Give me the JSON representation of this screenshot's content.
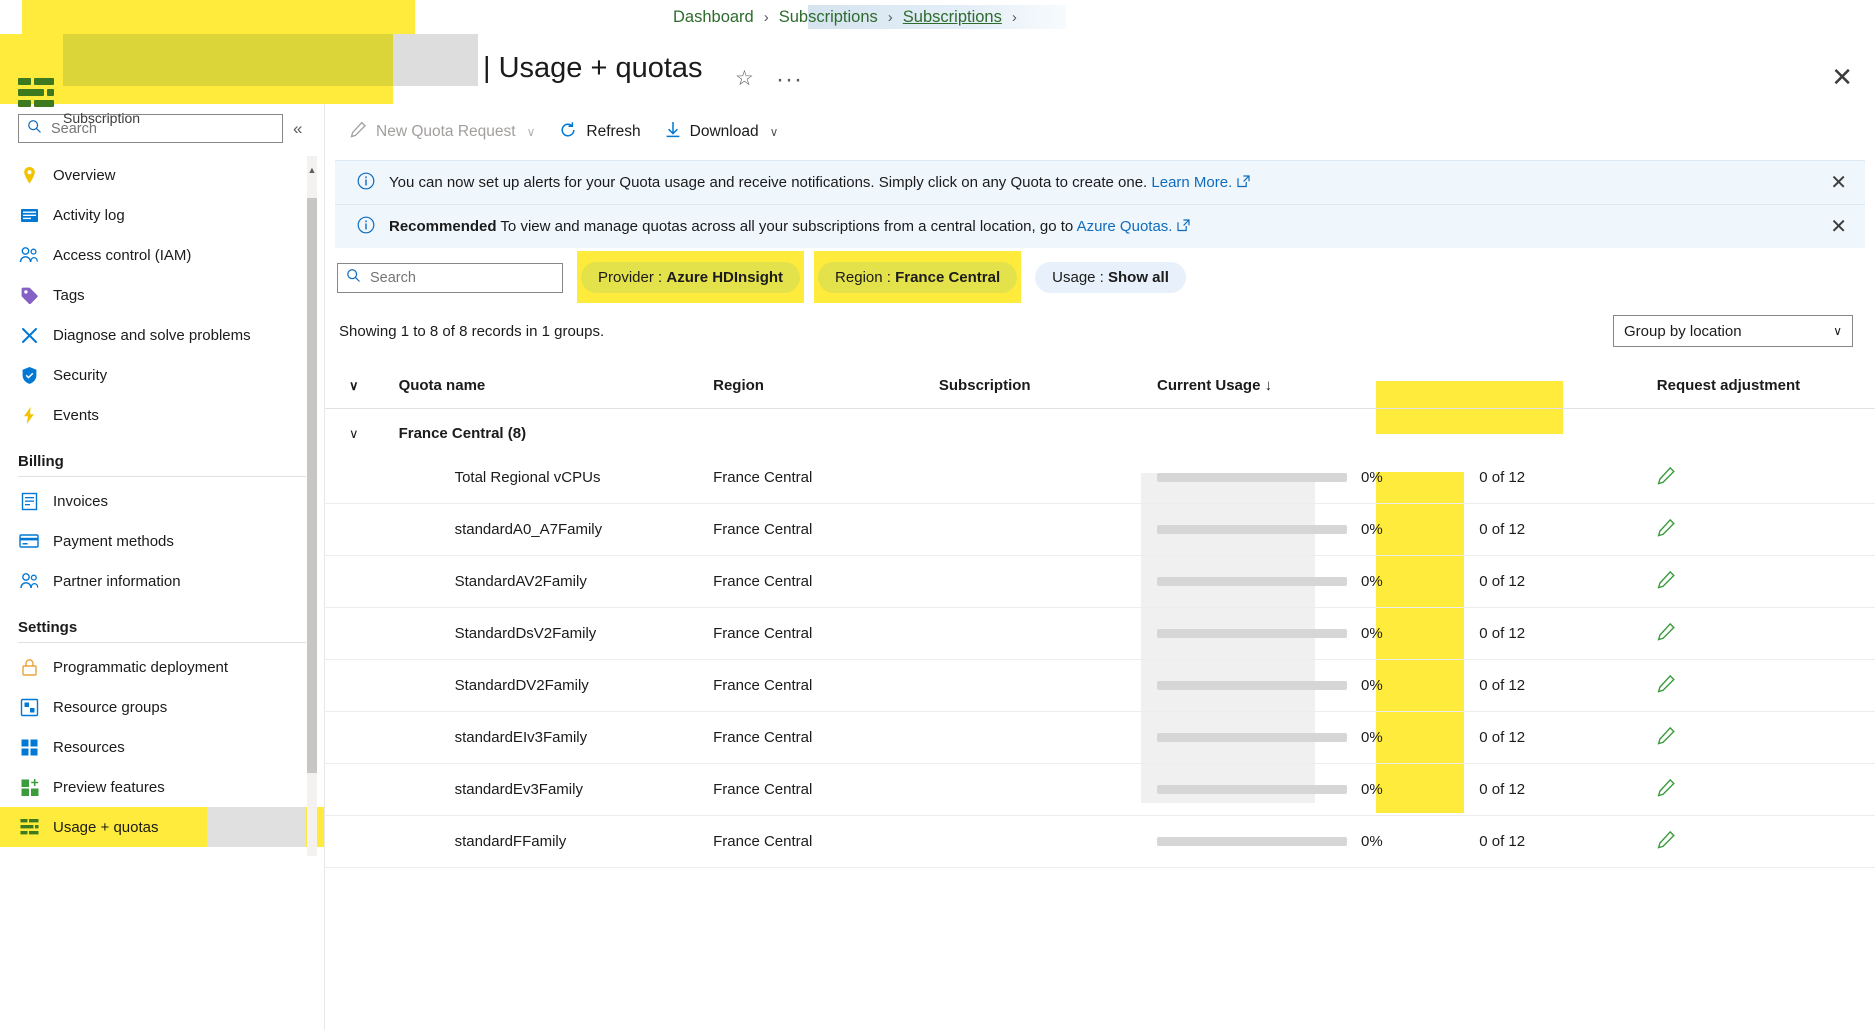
{
  "breadcrumb": {
    "items": [
      {
        "label": "Dashboard",
        "current": false
      },
      {
        "label": "Subscriptions",
        "current": false
      },
      {
        "label": "Subscriptions",
        "current": true
      }
    ],
    "separator": "›"
  },
  "header": {
    "title": "| Usage + quotas",
    "subtitle": "Subscription",
    "favorite_icon": "star-icon",
    "more_icon": "ellipsis-icon",
    "close_icon": "close-icon"
  },
  "sidebar": {
    "search_placeholder": "Search",
    "search_value": "",
    "collapse_label": "«",
    "items": [
      {
        "label": "Overview",
        "icon": "overview-icon",
        "color": "#f2c300",
        "selected": false
      },
      {
        "label": "Activity log",
        "icon": "activity-log-icon",
        "color": "#0078d4",
        "selected": false
      },
      {
        "label": "Access control (IAM)",
        "icon": "access-control-icon",
        "color": "#0078d4",
        "selected": false
      },
      {
        "label": "Tags",
        "icon": "tags-icon",
        "color": "#8661c5",
        "selected": false
      },
      {
        "label": "Diagnose and solve problems",
        "icon": "diagnose-icon",
        "color": "#0078d4",
        "selected": false
      },
      {
        "label": "Security",
        "icon": "security-shield-icon",
        "color": "#0078d4",
        "selected": false
      },
      {
        "label": "Events",
        "icon": "events-bolt-icon",
        "color": "#f2c300",
        "selected": false
      }
    ],
    "sections": [
      {
        "title": "Billing",
        "items": [
          {
            "label": "Invoices",
            "icon": "invoices-icon",
            "color": "#0078d4",
            "selected": false
          },
          {
            "label": "Payment methods",
            "icon": "payment-methods-icon",
            "color": "#0078d4",
            "selected": false
          },
          {
            "label": "Partner information",
            "icon": "partner-information-icon",
            "color": "#0078d4",
            "selected": false
          }
        ]
      },
      {
        "title": "Settings",
        "items": [
          {
            "label": "Programmatic deployment",
            "icon": "programmatic-deployment-icon",
            "color": "#e8a33d",
            "selected": false
          },
          {
            "label": "Resource groups",
            "icon": "resource-groups-icon",
            "color": "#0078d4",
            "selected": false
          },
          {
            "label": "Resources",
            "icon": "resources-icon",
            "color": "#0078d4",
            "selected": false
          },
          {
            "label": "Preview features",
            "icon": "preview-features-icon",
            "color": "#3b9c3b",
            "selected": false
          },
          {
            "label": "Usage + quotas",
            "icon": "usage-quotas-icon",
            "color": "#3d7a1f",
            "selected": true
          }
        ]
      }
    ]
  },
  "toolbar": {
    "new_quota_request": "New Quota Request",
    "new_quota_request_disabled": true,
    "refresh": "Refresh",
    "download": "Download",
    "chevron": "∨"
  },
  "banners": [
    {
      "icon": "info-icon",
      "bold": "",
      "text": "You can now set up alerts for your Quota usage and receive notifications. Simply click on any Quota to create one. ",
      "link": "Learn More.",
      "external_icon": "external-link-icon",
      "close_icon": "close-icon"
    },
    {
      "icon": "info-icon",
      "bold": "Recommended",
      "text": " To view and manage quotas across all your subscriptions from a central location, go to ",
      "link": "Azure Quotas.",
      "external_icon": "external-link-icon",
      "close_icon": "close-icon"
    }
  ],
  "filters": {
    "search_placeholder": "Search",
    "search_value": "",
    "pills": [
      {
        "label": "Provider :",
        "value": "Azure HDInsight",
        "highlighted": true
      },
      {
        "label": "Region :",
        "value": "France Central",
        "highlighted": true
      },
      {
        "label": "Usage :",
        "value": "Show all",
        "highlighted": false
      }
    ]
  },
  "results": {
    "showing_text": "Showing 1 to 8 of 8 records in 1 groups.",
    "group_by_label": "Group by location",
    "group_by_chevron": "∨"
  },
  "table": {
    "columns": {
      "quota_name": "Quota name",
      "region": "Region",
      "subscription": "Subscription",
      "current_usage": "Current Usage",
      "sort_arrow": "↓",
      "request_adjustment": "Request adjustment"
    },
    "group": {
      "label": "France Central (8)",
      "caret": "∨"
    },
    "rows": [
      {
        "quota_name": "Total Regional vCPUs",
        "region": "France Central",
        "subscription": "",
        "percent": "0%",
        "usage": "0 of 12",
        "bar_fill": 0,
        "edit_icon": "pencil-icon"
      },
      {
        "quota_name": "standardA0_A7Family",
        "region": "France Central",
        "subscription": "",
        "percent": "0%",
        "usage": "0 of 12",
        "bar_fill": 0,
        "edit_icon": "pencil-icon"
      },
      {
        "quota_name": "StandardAV2Family",
        "region": "France Central",
        "subscription": "",
        "percent": "0%",
        "usage": "0 of 12",
        "bar_fill": 0,
        "edit_icon": "pencil-icon"
      },
      {
        "quota_name": "StandardDsV2Family",
        "region": "France Central",
        "subscription": "",
        "percent": "0%",
        "usage": "0 of 12",
        "bar_fill": 0,
        "edit_icon": "pencil-icon"
      },
      {
        "quota_name": "StandardDV2Family",
        "region": "France Central",
        "subscription": "",
        "percent": "0%",
        "usage": "0 of 12",
        "bar_fill": 0,
        "edit_icon": "pencil-icon"
      },
      {
        "quota_name": "standardEIv3Family",
        "region": "France Central",
        "subscription": "",
        "percent": "0%",
        "usage": "0 of 12",
        "bar_fill": 0,
        "edit_icon": "pencil-icon"
      },
      {
        "quota_name": "standardEv3Family",
        "region": "France Central",
        "subscription": "",
        "percent": "0%",
        "usage": "0 of 12",
        "bar_fill": 0,
        "edit_icon": "pencil-icon"
      },
      {
        "quota_name": "standardFFamily",
        "region": "France Central",
        "subscription": "",
        "percent": "0%",
        "usage": "0 of 12",
        "bar_fill": 0,
        "edit_icon": "pencil-icon"
      }
    ]
  },
  "colors": {
    "highlight": "#ffeb3b",
    "link": "#0f6cbd",
    "breadcrumb": "#2e6b2e",
    "banner_bg": "#eff6fc",
    "pill_bg": "#e8f1fb",
    "pencil_green": "#3b9c3b"
  }
}
